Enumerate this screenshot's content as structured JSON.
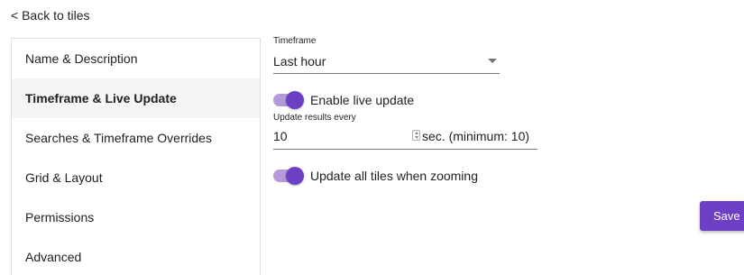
{
  "back_link": "< Back to tiles",
  "sidebar": {
    "items": [
      {
        "label": "Name & Description",
        "active": false
      },
      {
        "label": "Timeframe & Live Update",
        "active": true
      },
      {
        "label": "Searches & Timeframe Overrides",
        "active": false
      },
      {
        "label": "Grid & Layout",
        "active": false
      },
      {
        "label": "Permissions",
        "active": false
      },
      {
        "label": "Advanced",
        "active": false
      }
    ]
  },
  "form": {
    "timeframe": {
      "label": "Timeframe",
      "value": "Last hour"
    },
    "live_update": {
      "label": "Enable live update",
      "enabled": true
    },
    "update_interval": {
      "label": "Update results every",
      "value": "10",
      "suffix": "sec. (minimum: 10)"
    },
    "zoom_update": {
      "label": "Update all tiles when zooming",
      "enabled": true
    }
  },
  "actions": {
    "save_label": "Save"
  },
  "colors": {
    "accent": "#6d3fc4",
    "toggle_track": "#b49ad8",
    "active_nav_bg": "#f5f5f5"
  }
}
